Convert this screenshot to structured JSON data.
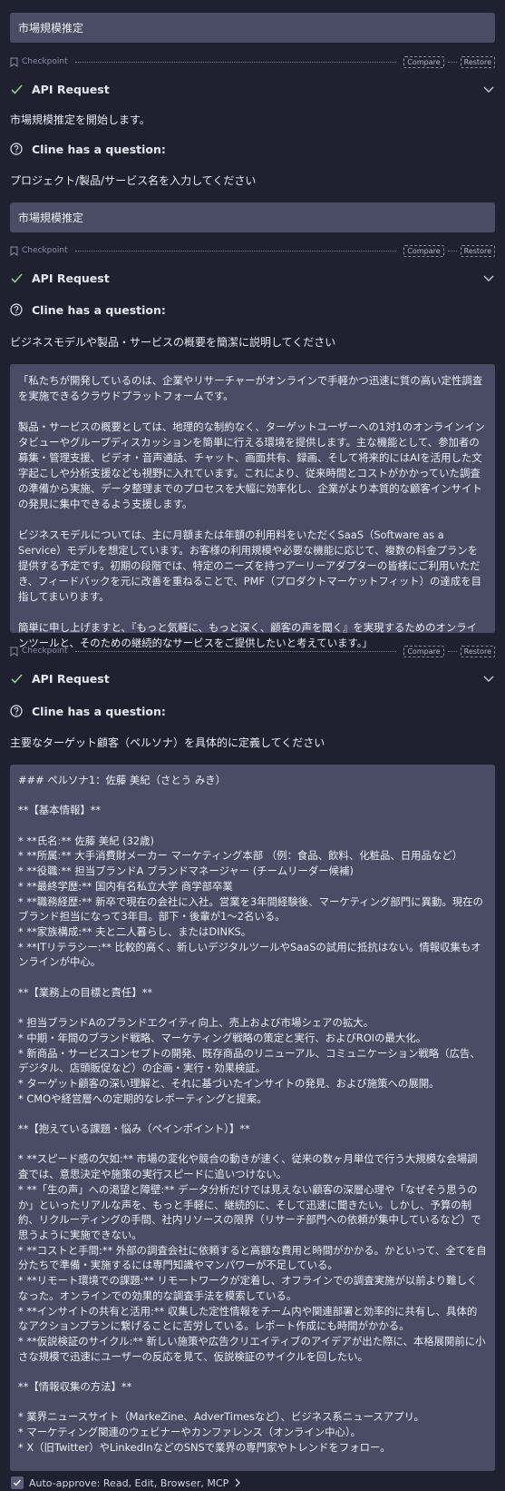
{
  "messages": {
    "user_1": "市場規模推定",
    "user_2": "市場規模推定",
    "checkpoint": {
      "label": "Checkpoint",
      "compare": "Compare",
      "restore": "Restore"
    },
    "api_request": "API Request",
    "start_text": "市場規模推定を開始します。",
    "question_title": "Cline has a question:",
    "q1": "プロジェクト/製品/サービス名を入力してください",
    "q2": "ビジネスモデルや製品・サービスの概要を簡潔に説明してください",
    "q3": "主要なターゲット顧客（ペルソナ）を具体的に定義してください"
  },
  "answer_2": {
    "paragraphs": [
      "「私たちが開発しているのは、企業やリサーチャーがオンラインで手軽かつ迅速に質の高い定性調査を実施できるクラウドプラットフォームです。",
      "製品・サービスの概要としては、地理的な制約なく、ターゲットユーザーへの1対1のオンラインインタビューやグループディスカッションを簡単に行える環境を提供します。主な機能として、参加者の募集・管理支援、ビデオ・音声通話、チャット、画面共有、録画、そして将来的にはAIを活用した文字起こしや分析支援なども視野に入れています。これにより、従来時間とコストがかかっていた調査の準備から実施、データ整理までのプロセスを大幅に効率化し、企業がより本質的な顧客インサイトの発見に集中できるよう支援します。",
      "ビジネスモデルについては、主に月額または年額の利用料をいただくSaaS（Software as a Service）モデルを想定しています。お客様の利用規模や必要な機能に応じて、複数の料金プランを提供する予定です。初期の段階では、特定のニーズを持つアーリーアダプターの皆様にご利用いただき、フィードバックを元に改善を重ねることで、PMF（プロダクトマーケットフィット）の達成を目指してまいります。",
      "簡単に申し上げますと、『もっと気軽に、もっと深く、顧客の声を聞く』を実現するためのオンラインツールと、そのための継続的なサービスをご提供したいと考えています。」"
    ]
  },
  "answer_3": {
    "lines": [
      "### ペルソナ1：佐藤 美紀（さとう みき）",
      "",
      "**【基本情報】**",
      "",
      "* **氏名:** 佐藤 美紀 (32歳)",
      "* **所属:** 大手消費財メーカー マーケティング本部 （例：食品、飲料、化粧品、日用品など）",
      "* **役職:** 担当ブランドA ブランドマネージャー (チームリーダー候補)",
      "* **最終学歴:** 国内有名私立大学 商学部卒業",
      "* **職務経歴:** 新卒で現在の会社に入社。営業を3年間経験後、マーケティング部門に異動。現在のブランド担当になって3年目。部下・後輩が1〜2名いる。",
      "* **家族構成:** 夫と二人暮らし、またはDINKS。",
      "* **ITリテラシー:** 比較的高く、新しいデジタルツールやSaaSの試用に抵抗はない。情報収集もオンラインが中心。",
      "",
      "**【業務上の目標と責任】**",
      "",
      "* 担当ブランドAのブランドエクイティ向上、売上および市場シェアの拡大。",
      "* 中期・年間のブランド戦略、マーケティング戦略の策定と実行、およびROIの最大化。",
      "* 新商品・サービスコンセプトの開発、既存商品のリニューアル、コミュニケーション戦略（広告、デジタル、店頭販促など）の企画・実行・効果検証。",
      "* ターゲット顧客の深い理解と、それに基づいたインサイトの発見、および施策への展開。",
      "* CMOや経営層への定期的なレポーティングと提案。",
      "",
      "**【抱えている課題・悩み（ペインポイント）】**",
      "",
      "* **スピード感の欠如:** 市場の変化や競合の動きが速く、従来の数ヶ月単位で行う大規模な会場調査では、意思決定や施策の実行スピードに追いつけない。",
      "* **「生の声」への渇望と障壁:** データ分析だけでは見えない顧客の深層心理や「なぜそう思うのか」といったリアルな声を、もっと手軽に、継続的に、そして迅速に聞きたい。しかし、予算の制約、リクルーティングの手間、社内リソースの限界（リサーチ部門への依頼が集中しているなど）で思うように実施できない。",
      "* **コストと手間:** 外部の調査会社に依頼すると高額な費用と時間がかかる。かといって、全てを自分たちで準備・実施するには専門知識やマンパワーが不足している。",
      "* **リモート環境での課題:** リモートワークが定着し、オフラインでの調査実施が以前より難しくなった。オンラインでの効果的な調査手法を模索している。",
      "* **インサイトの共有と活用:** 収集した定性情報をチーム内や関連部署と効率的に共有し、具体的なアクションプランに繋げることに苦労している。レポート作成にも時間がかかる。",
      "* **仮説検証のサイクル:** 新しい施策や広告クリエイティブのアイデアが出た際に、本格展開前に小さな規模で迅速にユーザーの反応を見て、仮説検証のサイクルを回したい。",
      "",
      "**【情報収集の方法】**",
      "",
      "* 業界ニュースサイト（MarkeZine、AdverTimesなど）、ビジネス系ニュースアプリ。",
      "* マーケティング関連のウェビナーやカンファレンス（オンライン中心）。",
      "* X（旧Twitter）やLinkedInなどのSNSで業界の専門家やトレンドをフォロー。"
    ]
  },
  "footer": {
    "auto_approve": "Auto-approve: Read, Edit, Browser, MCP"
  },
  "colors": {
    "accent_check": "#89d185",
    "bg": "#1f2030",
    "bubble": "#4a4c66"
  }
}
